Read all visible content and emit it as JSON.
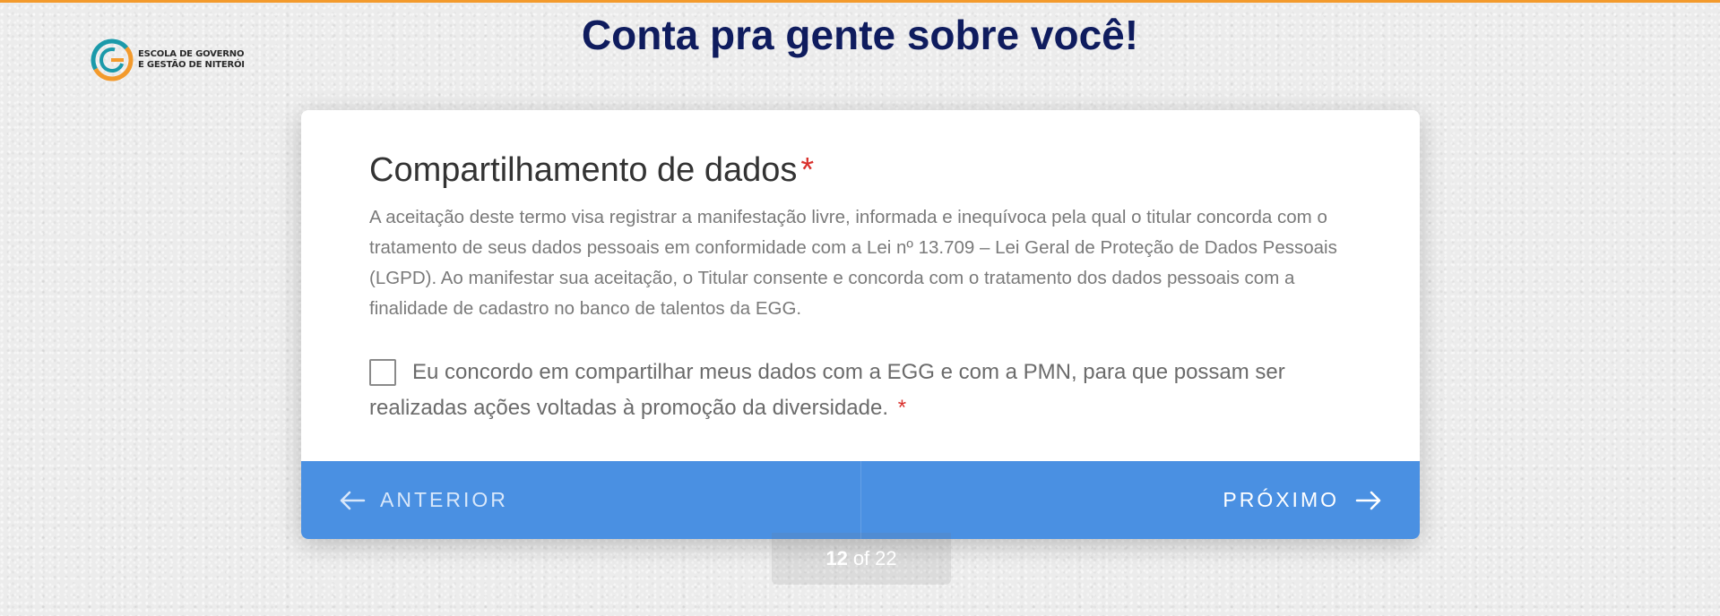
{
  "brand": {
    "accent_color": "#f39a2c",
    "logo_line1": "ESCOLA DE GOVERNO",
    "logo_line2": "E GESTÃO DE NITERÓI"
  },
  "page_title": "Conta pra gente sobre você!",
  "question": {
    "title": "Compartilhamento de dados",
    "required_marker": "*",
    "description": "A aceitação deste termo visa registrar a manifestação livre, informada e inequívoca pela qual o titular concorda com o tratamento de seus dados pessoais em conformidade com a Lei nº 13.709 – Lei Geral de Proteção de Dados Pessoais (LGPD). Ao manifestar sua aceitação, o Titular consente e concorda com o tratamento dos dados pessoais com a finalidade de cadastro no banco de talentos da EGG.",
    "consent_label": "Eu concordo em compartilhar meus dados com a EGG e com a PMN, para que possam ser realizadas ações voltadas à promoção da diversidade.",
    "consent_checked": false
  },
  "navigation": {
    "prev_label": "ANTERIOR",
    "next_label": "PRÓXIMO",
    "bar_color": "#4a90e2"
  },
  "pager": {
    "current": "12",
    "of_label": "of",
    "total": "22"
  }
}
